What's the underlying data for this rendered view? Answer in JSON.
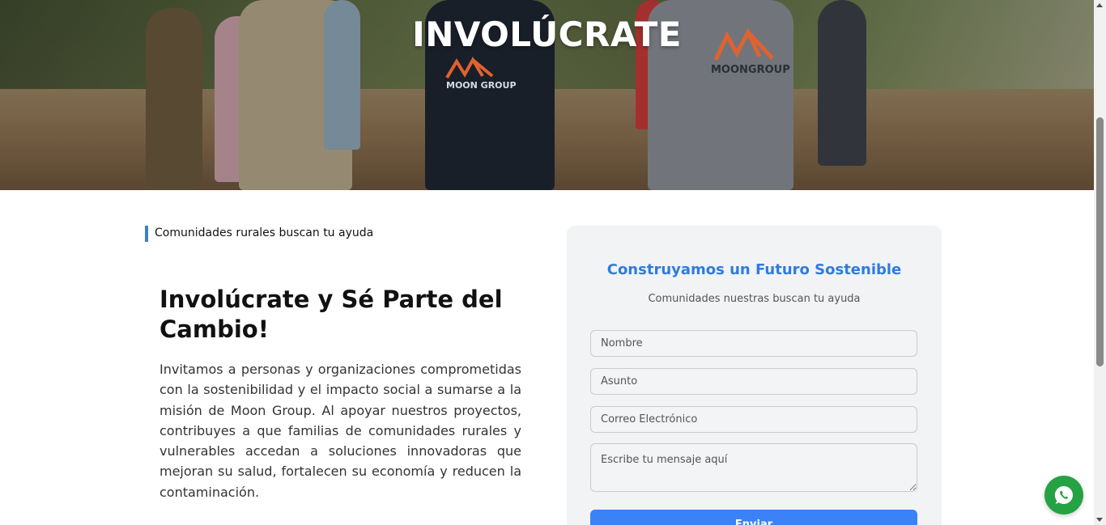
{
  "hero": {
    "title": "INVOLÚCRATE",
    "vest_logo_left": "MOON GROUP",
    "vest_logo_right": "MOONGROUP"
  },
  "intro": {
    "tagline": "Comunidades rurales buscan tu ayuda",
    "heading": "Involúcrate y Sé Parte del Cambio!",
    "body": "Invitamos a personas y organizaciones comprometidas con la sostenibilidad y el impacto social a sumarse a la misión de Moon Group. Al apoyar nuestros proyectos, contribuyes a que familias de comunidades rurales y vulnerables accedan a soluciones innovadoras que mejoran su salud, fortalecen su economía y reducen la contaminación."
  },
  "form": {
    "title": "Construyamos un Futuro Sostenible",
    "subtitle": "Comunidades nuestras buscan tu ayuda",
    "name_placeholder": "Nombre",
    "subject_placeholder": "Asunto",
    "email_placeholder": "Correo Electrónico",
    "message_placeholder": "Escribe tu mensaje aquí",
    "submit_label": "Enviar"
  },
  "floating": {
    "whatsapp_icon": "whatsapp-icon"
  },
  "colors": {
    "accent_blue": "#2f7be0",
    "button_blue": "#3b82f6",
    "tagline_bar": "#3b82c4",
    "whatsapp_green": "#25a244"
  }
}
